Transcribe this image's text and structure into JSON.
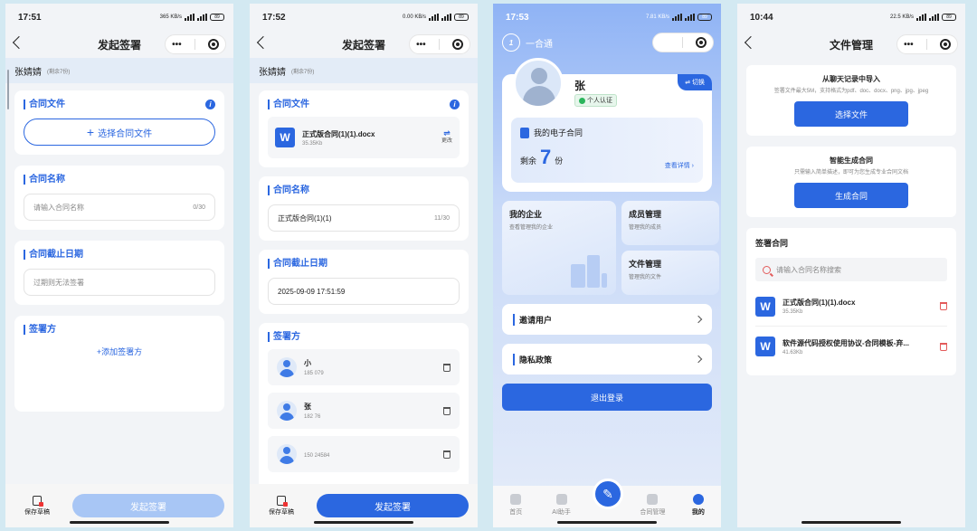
{
  "phone1": {
    "time": "17:51",
    "net": "365 KB/s",
    "battery": "89",
    "title": "发起签署",
    "user": "张婧婧",
    "remain": "(剩余7份)",
    "contract_file_label": "合同文件",
    "choose_file": "选择合同文件",
    "contract_name_label": "合同名称",
    "contract_name_placeholder": "请输入合同名称",
    "contract_name_count": "0/30",
    "deadline_label": "合同截止日期",
    "deadline_placeholder": "过期则无法签署",
    "signers_label": "签署方",
    "add_signer": "+添加签署方",
    "save_draft": "保存草稿",
    "submit": "发起签署"
  },
  "phone2": {
    "time": "17:52",
    "net": "0.00 KB/s",
    "battery": "89",
    "title": "发起签署",
    "user": "张婧婧",
    "remain": "(剩余7份)",
    "contract_file_label": "合同文件",
    "file_name": "正式版合同(1)(1).docx",
    "file_size": "35.35Kb",
    "change": "更改",
    "contract_name_label": "合同名称",
    "contract_name_value": "正式版合同(1)(1)",
    "contract_name_count": "11/30",
    "deadline_label": "合同截止日期",
    "deadline_value": "2025-09-09 17:51:59",
    "signers_label": "签署方",
    "signers": [
      {
        "name": "小",
        "phone": "185    079"
      },
      {
        "name": "张",
        "phone": "182    76"
      },
      {
        "name": "",
        "phone": "150    24584"
      }
    ],
    "save_draft": "保存草稿",
    "submit": "发起签署"
  },
  "phone3": {
    "time": "17:53",
    "net": "7.81 KB/s",
    "battery": "89",
    "app_name": "一合通",
    "logo_text": "1",
    "user_name": "张",
    "verified": "个人认证",
    "switch": "⇌ 切换",
    "my_contracts": "我的电子合同",
    "remain_prefix": "剩余",
    "remain_count": "7",
    "remain_unit": "份",
    "view_detail": "查看详情",
    "my_company": "我的企业",
    "my_company_sub": "查看管理我的企业",
    "member_mgmt": "成员管理",
    "member_mgmt_sub": "管理我的成员",
    "file_mgmt": "文件管理",
    "file_mgmt_sub": "管理我的文件",
    "invite": "邀请用户",
    "privacy": "隐私政策",
    "logout": "退出登录",
    "tabs": [
      "首页",
      "AI助手",
      "合同管理",
      "我的"
    ]
  },
  "phone4": {
    "time": "10:44",
    "net": "22.5 KB/s",
    "battery": "89",
    "title": "文件管理",
    "import_title": "从聊天记录中导入",
    "import_sub": "签署文件最大5M，支持格式为pdf、doc、docx、png、jpg、jpeg",
    "choose_file": "选择文件",
    "ai_title": "智能生成合同",
    "ai_sub": "只需输入简单描述，即可为您生成专业合同文档",
    "generate": "生成合同",
    "signed_title": "签署合同",
    "search_placeholder": "请输入合同名称搜索",
    "docs": [
      {
        "name": "正式版合同(1)(1).docx",
        "size": "35.35Kb"
      },
      {
        "name": "软件源代码授权使用协议-合同模板-弃...",
        "size": "41.63Kb"
      }
    ]
  },
  "icons": {
    "info": "i",
    "word": "W",
    "swap": "⇌",
    "pen": "✎",
    "more": "•••"
  },
  "colors": {
    "accent": "#2b67e0",
    "danger": "#e35b5b",
    "verified": "#2bb55c"
  }
}
